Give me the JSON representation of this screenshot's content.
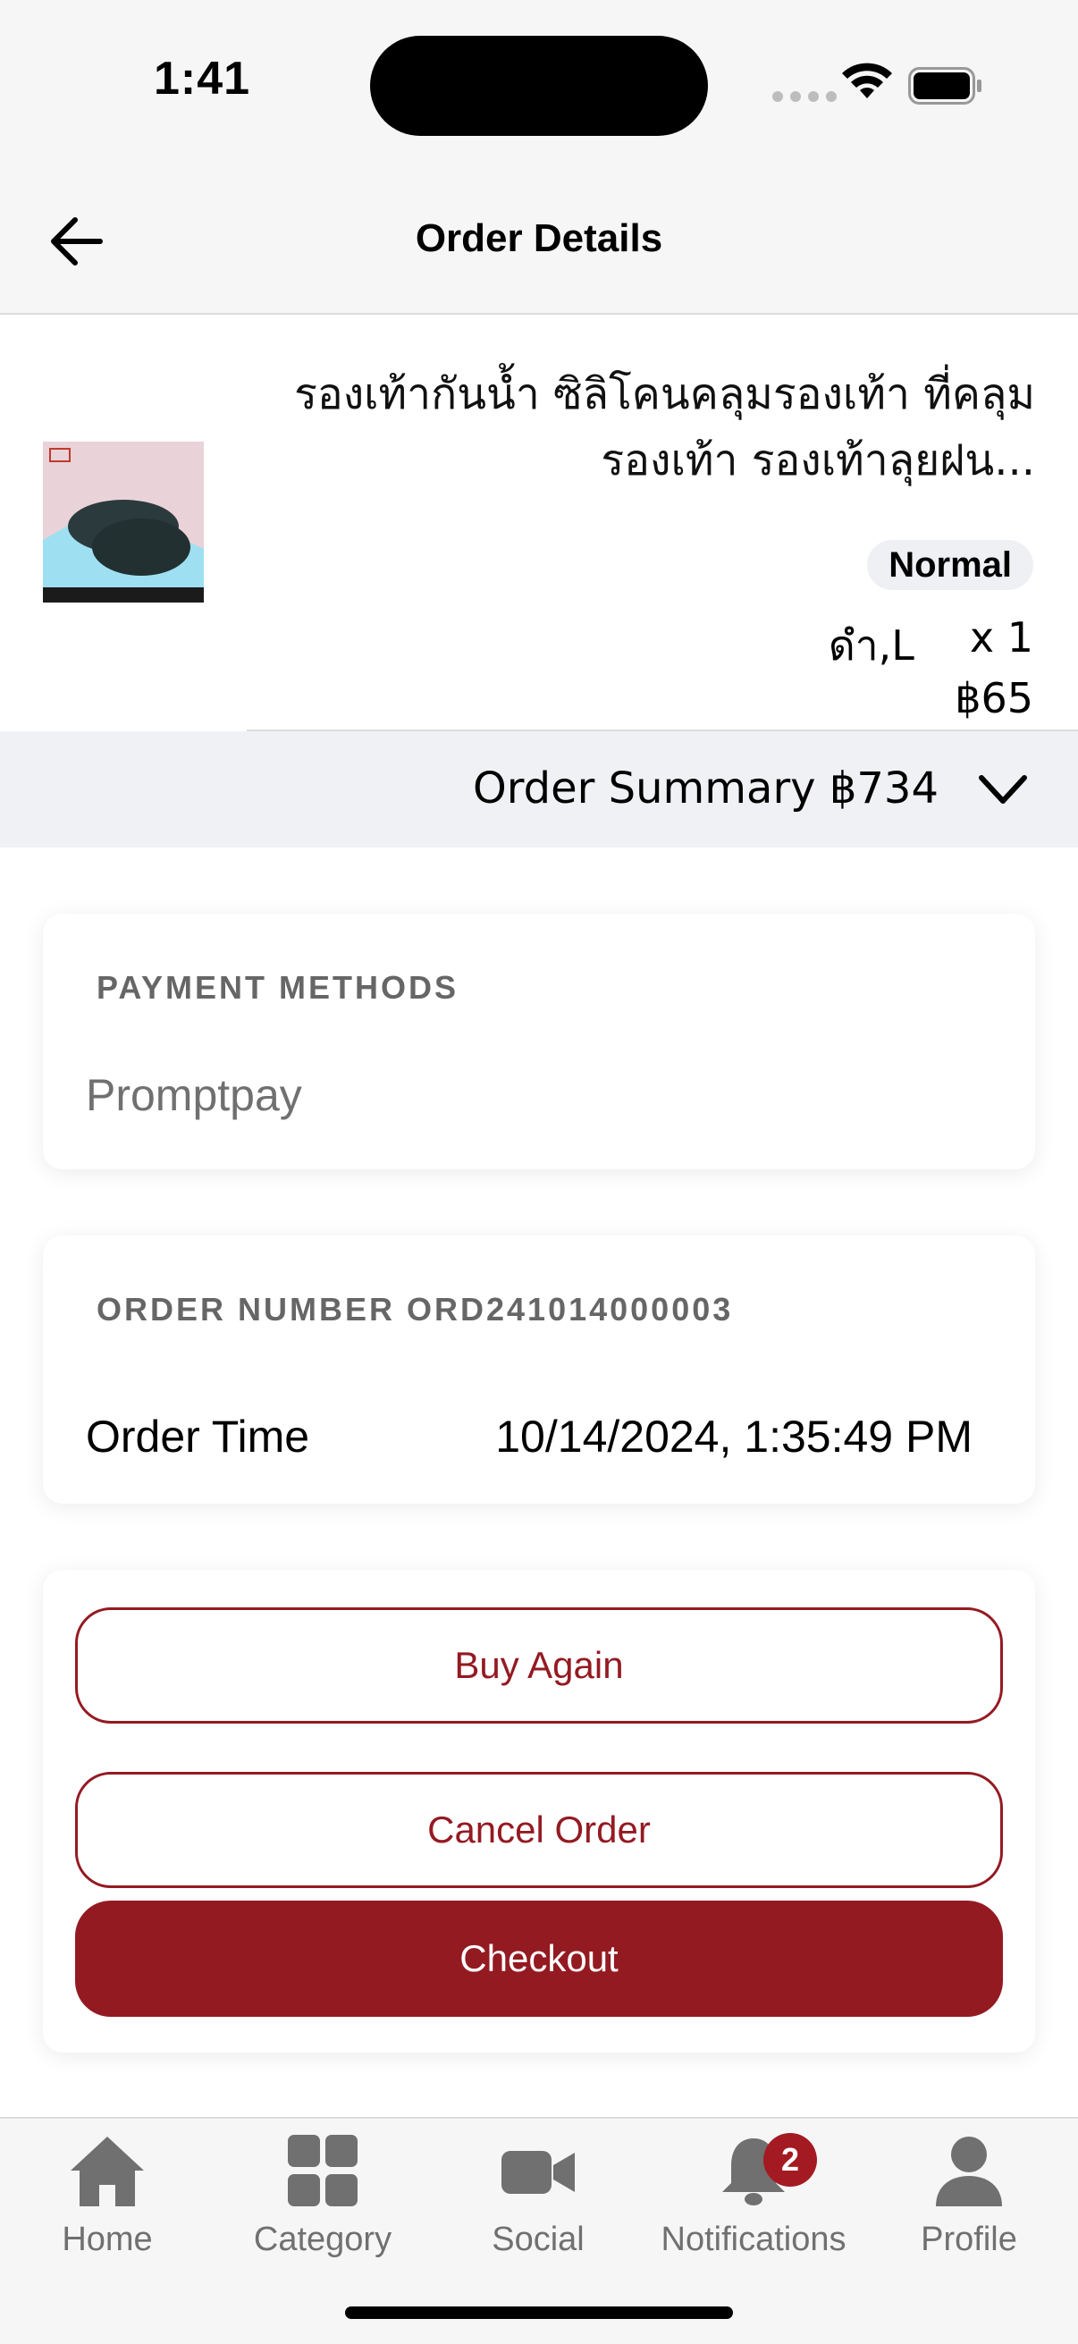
{
  "status_bar": {
    "time": "1:41"
  },
  "header": {
    "title": "Order Details"
  },
  "product": {
    "name": "รองเท้ากันน้ำ ซิลิโคนคลุมรองเท้า ที่คลุมรองเท้า รองเท้าลุยฝน...",
    "badge": "Normal",
    "variant": "ดำ,L",
    "quantity": "x 1",
    "price": "฿65"
  },
  "summary": {
    "label": "Order Summary ฿734"
  },
  "payment": {
    "title": "PAYMENT METHODS",
    "method": "Promptpay"
  },
  "order": {
    "title": "ORDER NUMBER ORD241014000003",
    "time_label": "Order Time",
    "time_value": "10/14/2024, 1:35:49 PM"
  },
  "actions": {
    "buy_again": "Buy Again",
    "cancel": "Cancel Order",
    "checkout": "Checkout"
  },
  "nav": {
    "items": [
      {
        "label": "Home",
        "icon": "home-icon"
      },
      {
        "label": "Category",
        "icon": "grid-icon"
      },
      {
        "label": "Social",
        "icon": "video-camera-icon"
      },
      {
        "label": "Notifications",
        "icon": "bell-icon",
        "badge": "2"
      },
      {
        "label": "Profile",
        "icon": "person-icon"
      }
    ]
  },
  "colors": {
    "accent": "#941a22",
    "muted": "#707070",
    "summary_bg": "#eff1f5"
  }
}
